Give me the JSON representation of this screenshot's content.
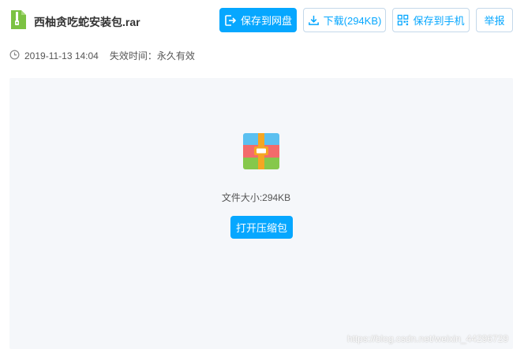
{
  "file": {
    "name": "西柚贪吃蛇安装包.rar",
    "icon": "zip-file-icon"
  },
  "toolbar": {
    "save_to_disk_label": "保存到网盘",
    "download_label": "下载(294KB)",
    "save_to_phone_label": "保存到手机",
    "report_label": "举报"
  },
  "meta": {
    "date": "2019-11-13 14:04",
    "expiry": "失效时间：永久有效"
  },
  "preview": {
    "size_text": "文件大小:294KB",
    "open_label": "打开压缩包"
  },
  "watermark": "https://blog.csdn.net/weixin_44296729",
  "colors": {
    "accent": "#06a7ff",
    "preview_bg": "#f5f7fa"
  }
}
